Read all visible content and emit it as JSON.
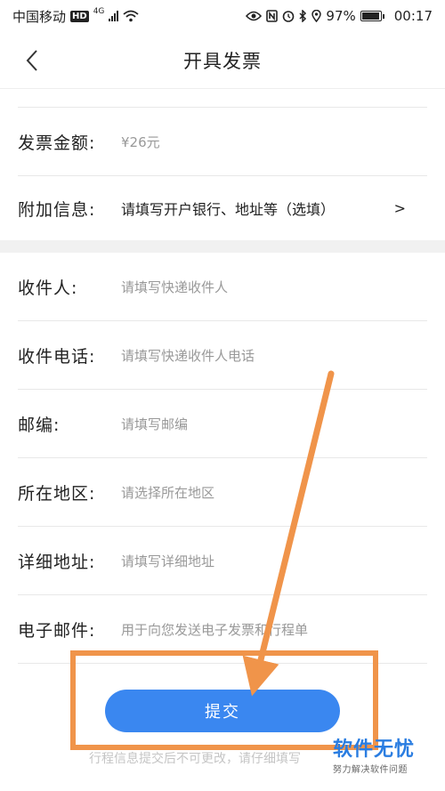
{
  "status_bar": {
    "carrier": "中国移动",
    "network_badge": "HD",
    "signal_tag": "4G",
    "battery": "97%",
    "battery_level": 0.97,
    "time": "00:17",
    "icons": [
      "hd-icon",
      "signal-icon",
      "wifi-icon",
      "eye-icon",
      "nfc-icon",
      "alarm-icon",
      "bluetooth-icon",
      "location-icon",
      "battery-icon"
    ]
  },
  "nav": {
    "back_icon": "chevron-left-icon",
    "title": "开具发票"
  },
  "invoice": {
    "amount_label": "发票金额:",
    "amount_value": "¥26元",
    "extra_label": "附加信息:",
    "extra_value": "请填写开户银行、地址等（选填）",
    "extra_arrow": ">"
  },
  "shipping": {
    "recipient_label": "收件人:",
    "recipient_placeholder": "请填写快递收件人",
    "phone_label": "收件电话:",
    "phone_placeholder": "请填写快递收件人电话",
    "zip_label": "邮编:",
    "zip_placeholder": "请填写邮编",
    "region_label": "所在地区:",
    "region_placeholder": "请选择所在地区",
    "address_label": "详细地址:",
    "address_placeholder": "请填写详细地址",
    "email_label": "电子邮件:",
    "email_placeholder": "用于向您发送电子发票和行程单"
  },
  "submit": {
    "label": "提交"
  },
  "footer_notice": "行程信息提交后不可更改，请仔细填写",
  "watermark": {
    "title": "软件无忧",
    "subtitle": "努力解决软件问题"
  },
  "colors": {
    "accent": "#3a87f0",
    "annotation": "#f0944a",
    "watermark": "#2a7de1"
  }
}
